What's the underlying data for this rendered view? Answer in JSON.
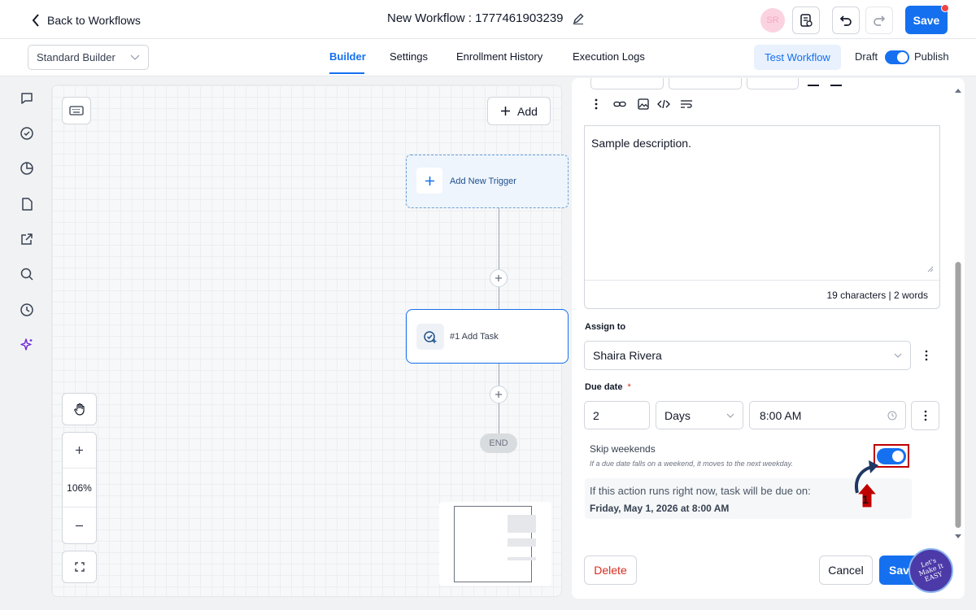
{
  "header": {
    "back_label": "Back to Workflows",
    "workflow_title": "New Workflow : 1777461903239",
    "avatar_initials": "SR",
    "save_label": "Save"
  },
  "subbar": {
    "builder_mode": "Standard Builder",
    "tabs": [
      {
        "label": "Builder",
        "active": true
      },
      {
        "label": "Settings",
        "active": false
      },
      {
        "label": "Enrollment History",
        "active": false
      },
      {
        "label": "Execution Logs",
        "active": false
      }
    ],
    "test_label": "Test Workflow",
    "draft_label": "Draft",
    "publish_label": "Publish",
    "published": true
  },
  "rail": {
    "icons": [
      "chat-icon",
      "check-circle-icon",
      "pie-chart-icon",
      "file-icon",
      "external-link-icon",
      "search-icon",
      "history-icon",
      "sparkle-icon"
    ]
  },
  "canvas": {
    "add_label": "Add",
    "trigger_label": "Add New Trigger",
    "task_label": "#1 Add Task",
    "end_label": "END",
    "zoom_level": "106%"
  },
  "panel": {
    "description_text": "Sample description.",
    "char_count": "19 characters | 2 words",
    "assign_label": "Assign to",
    "assignee": "Shaira Rivera",
    "due_label": "Due date",
    "required_mark": "*",
    "due_amount": "2",
    "due_unit": "Days",
    "due_time": "8:00 AM",
    "skip_title": "Skip weekends",
    "skip_help": "If a due date falls on a weekend, it moves to the next weekday.",
    "skip_enabled": true,
    "preview_label": "If this action runs right now, task will be due on:",
    "preview_date": "Friday, May 1, 2026 at 8:00 AM",
    "delete_label": "Delete",
    "cancel_label": "Cancel",
    "save_label": "Save"
  },
  "annotation": {
    "step_number": "1",
    "highlight_color": "#c00000"
  },
  "watermark": {
    "text": "Let's Make It EASY"
  },
  "colors": {
    "primary": "#1570ef",
    "danger": "#d92d20"
  }
}
